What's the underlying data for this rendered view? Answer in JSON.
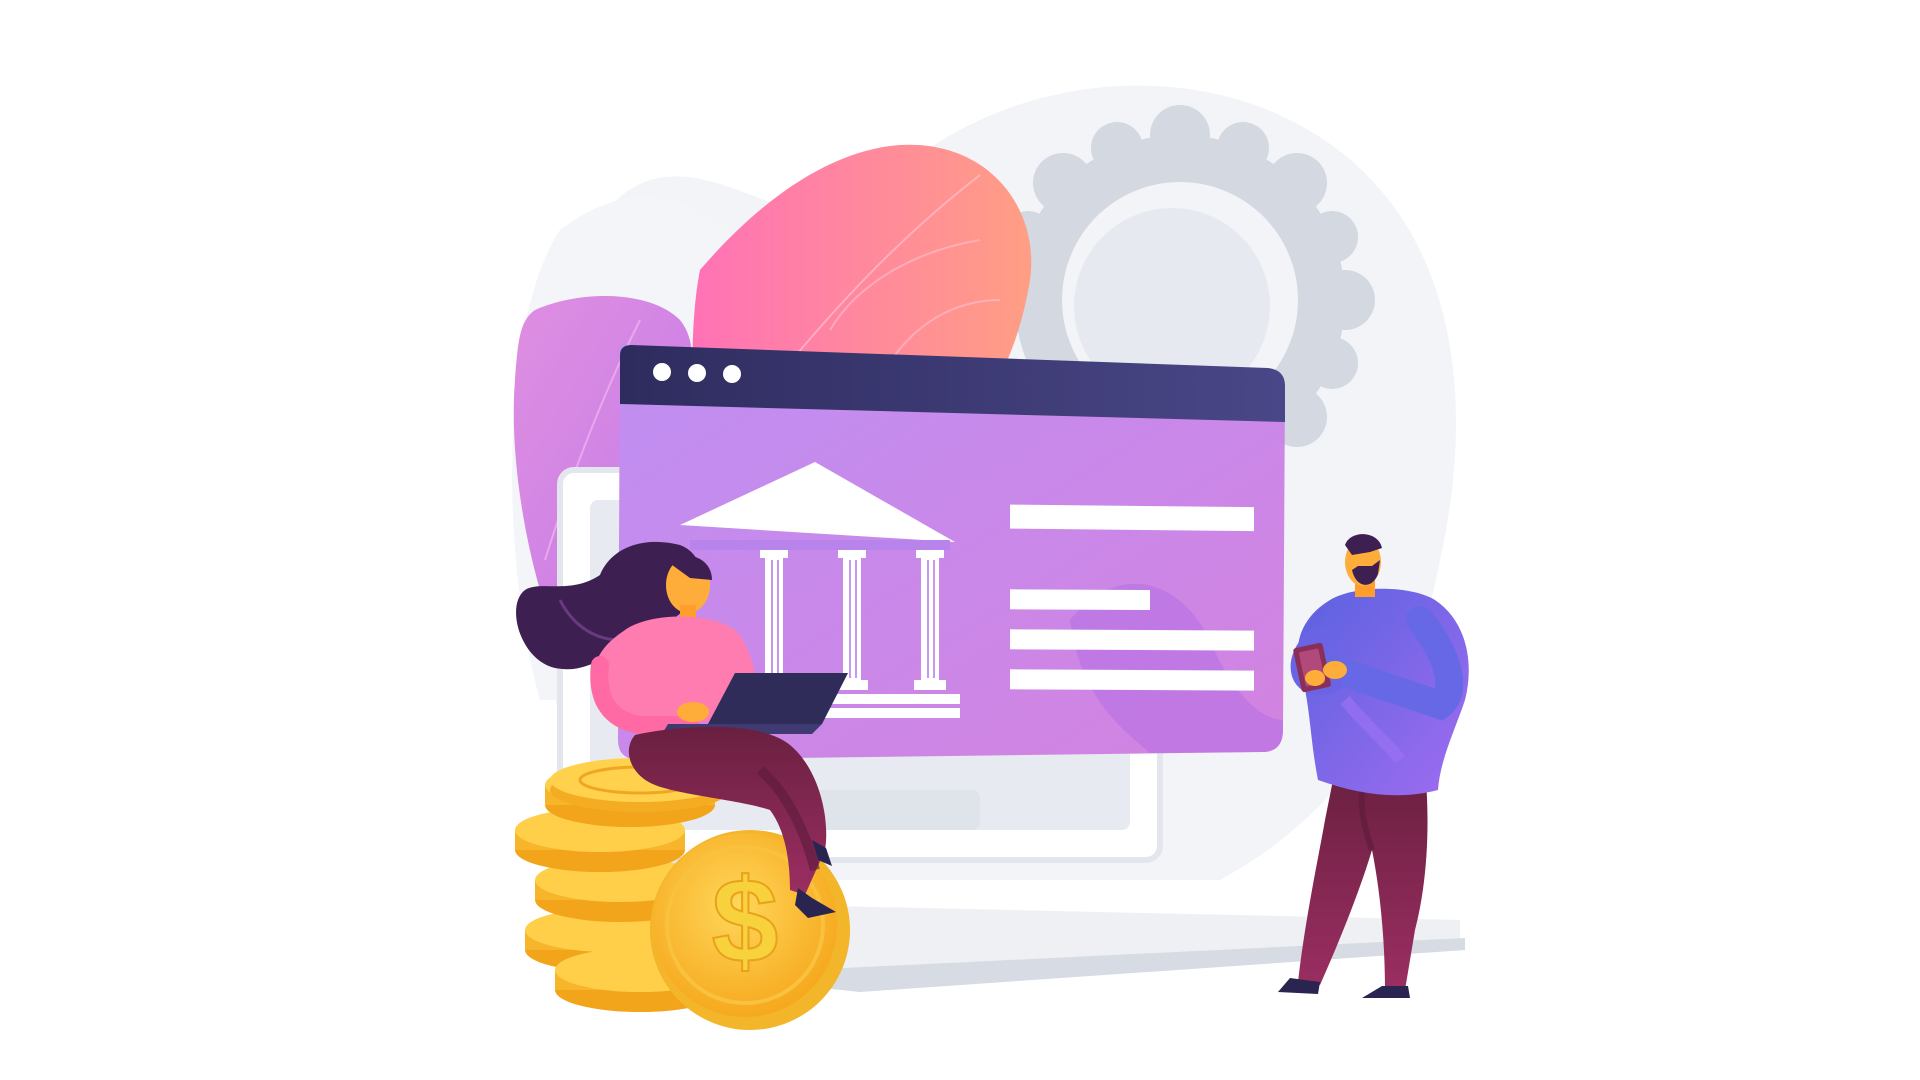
{
  "illustration": {
    "subject": "online banking",
    "dollar_symbol": "$"
  },
  "palette": {
    "background": "#ffffff",
    "backdrop_blob": "#f1f3f7",
    "leaf_pink": "#ff80a8",
    "leaf_peach": "#ff9a86",
    "leaf_violet": "#d98be0",
    "gear": "#d7dbe3",
    "window_bar": "#3a3a6e",
    "window_body": "#c58be8",
    "bank_white": "#ffffff",
    "coin_gold": "#ffc83a",
    "coin_dark": "#f2a51a",
    "woman_top": "#ff7fb0",
    "woman_pants": "#8b2a55",
    "hair": "#3b1f4f",
    "man_top": "#7b6cf0",
    "man_pants": "#7d2348",
    "skin": "#ffae3d",
    "device_dark": "#2f2c5a"
  }
}
